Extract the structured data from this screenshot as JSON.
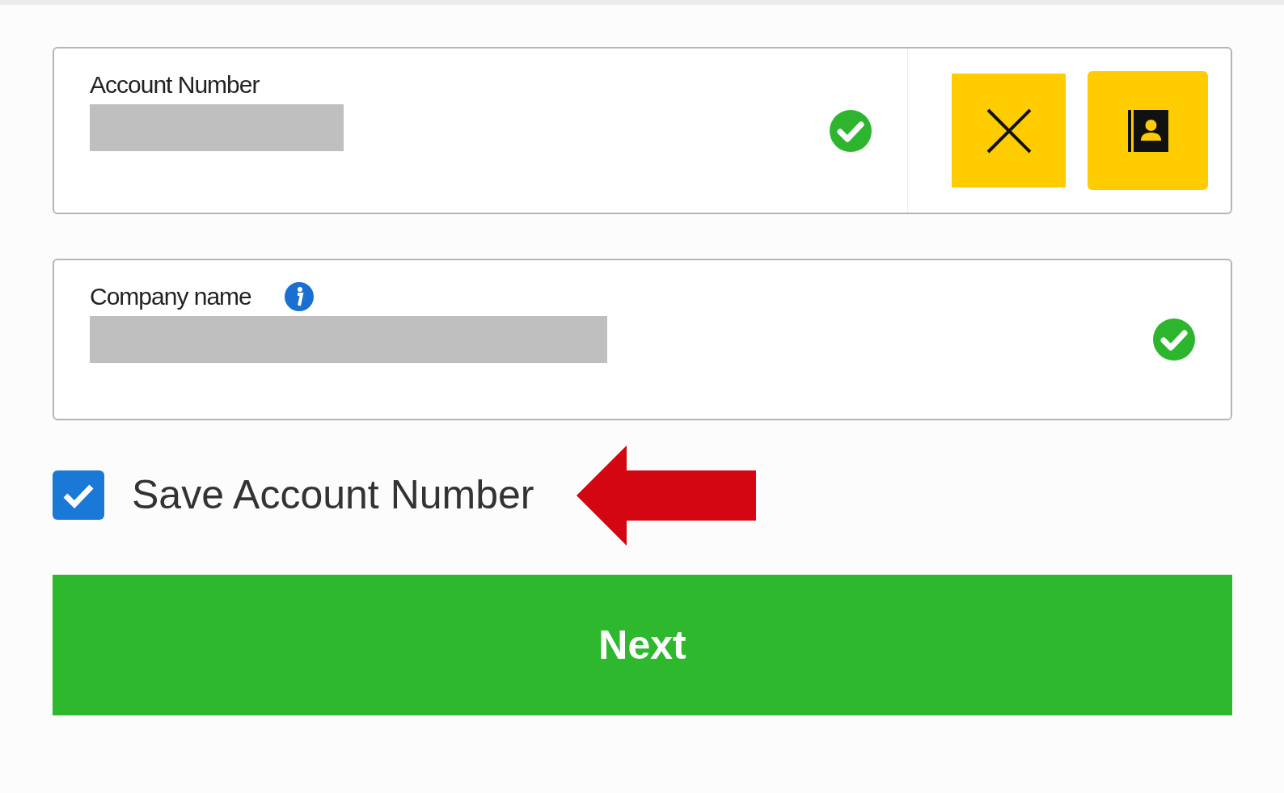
{
  "fields": [
    {
      "label": "Account Number",
      "info": false,
      "redacted": true,
      "valid": true,
      "buttons": [
        {
          "kind": "clear"
        },
        {
          "kind": "contacts"
        }
      ]
    },
    {
      "label": "Company name",
      "info": true,
      "redacted": true,
      "valid": true
    }
  ],
  "save": {
    "label": "Save Account Number",
    "checked": true
  },
  "annotation": {
    "kind": "arrow"
  },
  "next_button": "Next"
}
